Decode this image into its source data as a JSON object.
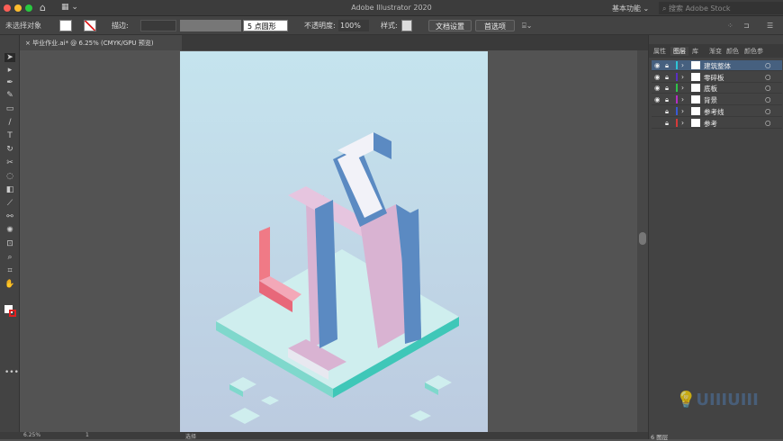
{
  "window": {
    "title": "Adobe Illustrator 2020",
    "workspace": "基本功能",
    "search_placeholder": "搜索 Adobe Stock"
  },
  "control": {
    "selection": "未选择对象",
    "stroke_label": "描边:",
    "brush": "5 点圆形",
    "opacity_label": "不透明度:",
    "opacity": "100%",
    "style_label": "样式:",
    "doc_setup": "文档设置",
    "preferences": "首选项"
  },
  "tab": {
    "close": "×",
    "label": "毕业作业.ai* @ 6.25% (CMYK/GPU 预览)"
  },
  "panel": {
    "tabs": [
      "属性",
      "图层",
      "库",
      "渐变",
      "颜色",
      "颜色参"
    ],
    "layers": [
      {
        "name": "建筑整体",
        "color": "#2ec4d6",
        "visible": true,
        "selected": true
      },
      {
        "name": "零碎板",
        "color": "#5a2fc2",
        "visible": true,
        "selected": false
      },
      {
        "name": "底板",
        "color": "#2fc24a",
        "visible": true,
        "selected": false
      },
      {
        "name": "背景",
        "color": "#b42fc2",
        "visible": true,
        "selected": false
      },
      {
        "name": "参考线",
        "color": "#3a5ad6",
        "visible": false,
        "selected": false
      },
      {
        "name": "参考",
        "color": "#d63a3a",
        "visible": false,
        "selected": false
      }
    ],
    "count": "6 图层"
  },
  "status": {
    "zoom": "6.25%",
    "page": "1",
    "tool": "选择"
  },
  "watermark": "UIIIUIII"
}
